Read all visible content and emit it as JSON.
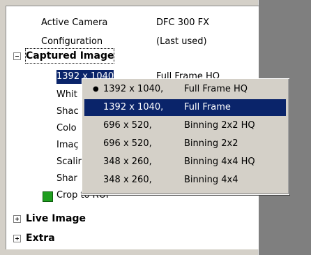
{
  "properties": {
    "active_camera": {
      "label": "Active Camera",
      "value": "DFC 300 FX"
    },
    "configuration": {
      "label": "Configuration",
      "value": "(Last used)"
    }
  },
  "sections": {
    "captured_image": {
      "label": "Captured Image",
      "expanded": true
    },
    "live_image": {
      "label": "Live Image",
      "expanded": false
    },
    "extra": {
      "label": "Extra",
      "expanded": false
    }
  },
  "captured_items": [
    {
      "label": "1392 x 1040",
      "value": "Full Frame HQ"
    },
    {
      "label": "Whit"
    },
    {
      "label": "Shac"
    },
    {
      "label": "Colo"
    },
    {
      "label": "Imaç"
    },
    {
      "label": "Scalir"
    },
    {
      "label": "Shar"
    }
  ],
  "crop": {
    "label": "Crop to ROI",
    "color": "#1f9e1f"
  },
  "menu": {
    "items": [
      {
        "resolution": "1392 x 1040,",
        "mode": "Full Frame HQ",
        "checked": true
      },
      {
        "resolution": "1392 x 1040,",
        "mode": "Full Frame",
        "highlighted": true
      },
      {
        "resolution": "696 x 520,",
        "mode": "Binning 2x2 HQ"
      },
      {
        "resolution": "696 x 520,",
        "mode": "Binning 2x2"
      },
      {
        "resolution": "348 x 260,",
        "mode": "Binning 4x4 HQ"
      },
      {
        "resolution": "348 x 260,",
        "mode": "Binning 4x4"
      }
    ],
    "bullet": "●"
  },
  "colors": {
    "selection": "#0a246a",
    "menu_bg": "#d4d0c8"
  }
}
